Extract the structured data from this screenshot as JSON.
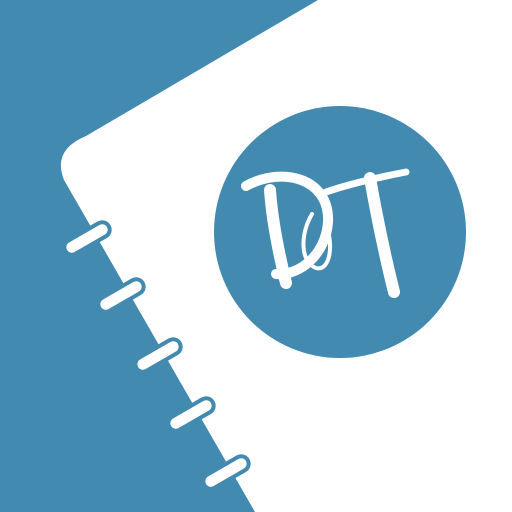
{
  "icon": {
    "logo_text": "DT",
    "colors": {
      "background": "#428aaf",
      "page": "#ffffff",
      "emblem": "#428aaf",
      "emblem_text": "#ffffff",
      "ring_fill": "#ffffff",
      "ring_outline": "#428aaf"
    },
    "ring_count": 5
  }
}
